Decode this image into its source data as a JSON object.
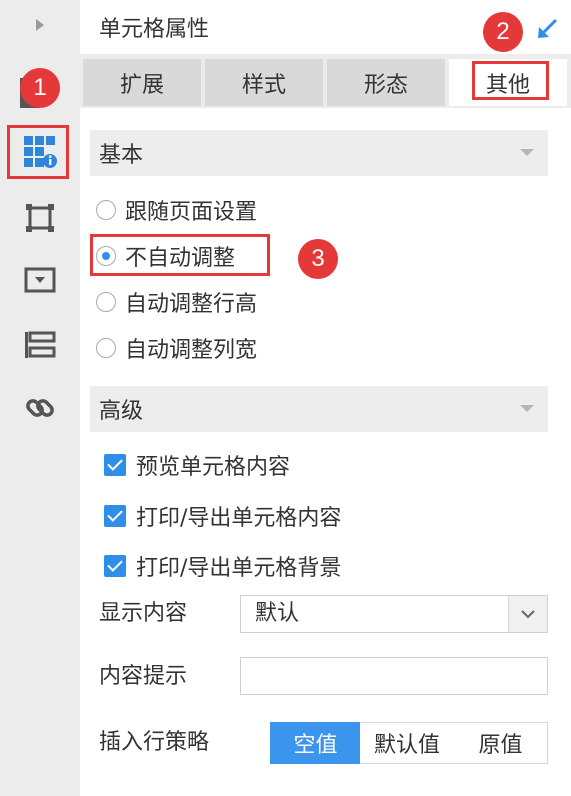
{
  "panel": {
    "title": "单元格属性"
  },
  "tabs": [
    {
      "label": "扩展"
    },
    {
      "label": "样式"
    },
    {
      "label": "形态"
    },
    {
      "label": "其他"
    }
  ],
  "active_tab": "其他",
  "sections": {
    "basic": {
      "title": "基本",
      "options": [
        "跟随页面设置",
        "不自动调整",
        "自动调整行高",
        "自动调整列宽"
      ],
      "selected": "不自动调整"
    },
    "advanced": {
      "title": "高级",
      "checks": [
        "预览单元格内容",
        "打印/导出单元格内容",
        "打印/导出单元格背景"
      ],
      "display_label": "显示内容",
      "display_value": "默认",
      "tooltip_label": "内容提示",
      "tooltip_value": "",
      "insert_label": "插入行策略",
      "insert_options": [
        "空值",
        "默认值",
        "原值"
      ],
      "insert_selected": "空值"
    }
  },
  "rail_icons": [
    "expand-arrow-icon",
    "cell-attributes-icon",
    "border-icon",
    "widget-icon",
    "floating-element-icon",
    "hyperlink-icon"
  ],
  "annotations": {
    "one": "1",
    "two": "2",
    "three": "3"
  },
  "colors": {
    "accent": "#2f8fe8",
    "annotation_red": "#e53838",
    "rail_bg": "#ececec"
  }
}
